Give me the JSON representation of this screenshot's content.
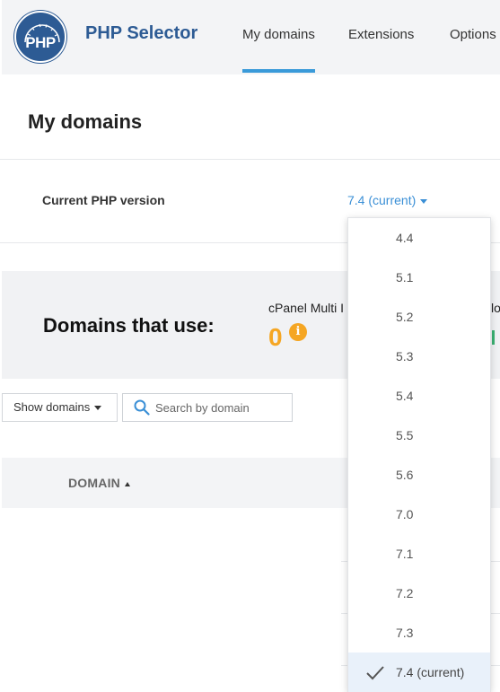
{
  "header": {
    "logo_text": "PHP",
    "app_title": "PHP Selector",
    "tabs": [
      {
        "label": "My domains",
        "active": true
      },
      {
        "label": "Extensions",
        "active": false
      },
      {
        "label": "Options",
        "active": false
      }
    ]
  },
  "page": {
    "title": "My domains"
  },
  "php_version": {
    "label": "Current PHP version",
    "value": "7.4 (current)"
  },
  "usage": {
    "title": "Domains that use:",
    "subtitle": "cPanel Multi I",
    "count": "0",
    "info_icon": "i",
    "subtitle2": "lo"
  },
  "controls": {
    "show_domains_label": "Show domains",
    "search_placeholder": "Search by domain"
  },
  "table": {
    "columns": [
      {
        "label": "DOMAIN",
        "sort": "ascending"
      }
    ]
  },
  "dropdown": {
    "options": [
      {
        "label": "4.4",
        "selected": false
      },
      {
        "label": "5.1",
        "selected": false
      },
      {
        "label": "5.2",
        "selected": false
      },
      {
        "label": "5.3",
        "selected": false
      },
      {
        "label": "5.4",
        "selected": false
      },
      {
        "label": "5.5",
        "selected": false
      },
      {
        "label": "5.6",
        "selected": false
      },
      {
        "label": "7.0",
        "selected": false
      },
      {
        "label": "7.1",
        "selected": false
      },
      {
        "label": "7.2",
        "selected": false
      },
      {
        "label": "7.3",
        "selected": false
      },
      {
        "label": "7.4 (current)",
        "selected": true
      }
    ]
  },
  "colors": {
    "brand_blue": "#2d5b94",
    "link_blue": "#3a8fd6",
    "accent_underline": "#3a9ad9",
    "count_orange": "#f5a623",
    "selected_bg": "#e9f1fa"
  },
  "icons": [
    "php-logo-icon",
    "caret-down-icon",
    "info-icon",
    "search-icon",
    "sort-ascending-icon",
    "checkmark-icon"
  ]
}
